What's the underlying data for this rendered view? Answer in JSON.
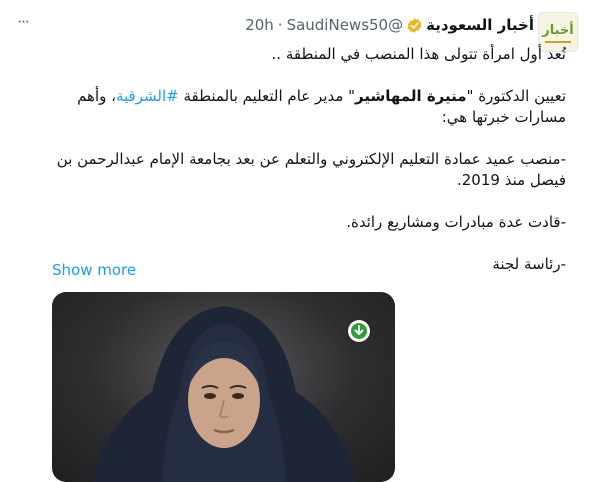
{
  "header": {
    "author_name": "أخبار السعودية",
    "handle": "@SaudiNews50",
    "separator": "·",
    "time": "20h",
    "more_glyph": "···"
  },
  "avatar": {
    "logo_text": "أخبار"
  },
  "tweet": {
    "line1": "تُعد أول امرأة تتولى هذا المنصب في المنطقة ..",
    "p2_before": "تعيين الدكتورة \"",
    "p2_name": "منيرة المهاشير",
    "p2_mid": "\" مدير عام التعليم بالمنطقة ",
    "p2_hashtag": "#الشرقية",
    "p2_after": "، وأهم مسارات خبرتها هي:",
    "p3": "-منصب عميد عمادة التعليم الإلكتروني والتعلم عن بعد بجامعة الإمام عبدالرحمن بن فيصل منذ 2019.",
    "p4": "-قادت عدة مبادرات ومشاريع رائدة.",
    "p5": "-رئاسة لجنة"
  },
  "show_more": "Show more",
  "icons": {
    "verified": "verified-badge-icon",
    "more": "more-options-icon",
    "download": "download-arrow-icon"
  },
  "colors": {
    "link": "#1d9bf0",
    "verified": "#e8b829",
    "download_green": "#2f9e3a"
  }
}
